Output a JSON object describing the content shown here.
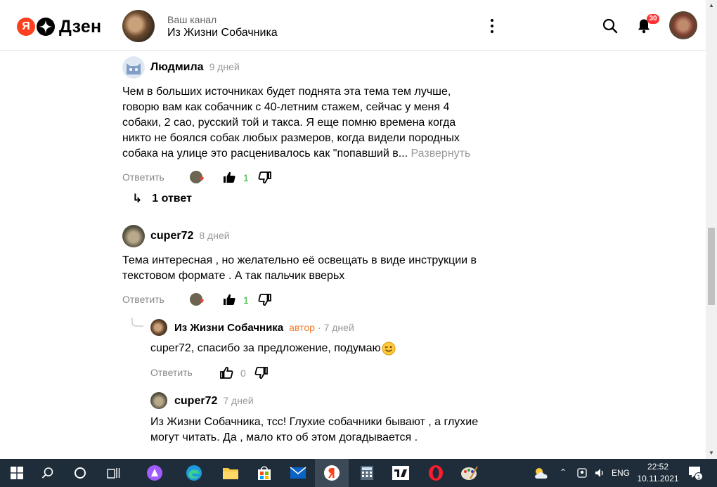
{
  "header": {
    "logo_letter": "Я",
    "logo_text": "Дзен",
    "channel_subtitle": "Ваш канал",
    "channel_title": "Из Жизни Собачника",
    "notifications_count": "30"
  },
  "comments": [
    {
      "author": "Людмила",
      "time": "9 дней",
      "text": "Чем в больших источниках будет поднята эта тема тем лучше, говорю вам как собачник с 40-летним стажем, сейчас у меня 4 собаки, 2 сао, русский той и такса. Я еще помню времена когда никто не боялся собак любых размеров, когда видели породных собака на улице это расценивалось как \"попавший в...",
      "expand_label": "Развернуть",
      "reply_label": "Ответить",
      "likes": "1",
      "replies_label": "1 ответ"
    },
    {
      "author": "cuper72",
      "time": "8 дней",
      "text": "Тема интересная , но желательно её освещать в виде инструкции в текстовом формате . А так пальчик вверьх",
      "reply_label": "Ответить",
      "likes": "1"
    }
  ],
  "replies": [
    {
      "author": "Из Жизни Собачника",
      "author_badge": "автор",
      "separator": "·",
      "time": "7 дней",
      "text": "cuper72, спасибо за предложение, подумаю",
      "reply_label": "Ответить",
      "likes": "0"
    },
    {
      "author": "cuper72",
      "time": "7 дней",
      "text": "Из Жизни Собачника, тсс! Глухие собачники бывают , а глухие могут читать. Да , мало кто об этом догадывается ."
    }
  ],
  "taskbar": {
    "language": "ENG",
    "time": "22:52",
    "date": "10.11.2021",
    "notification_count": "1"
  },
  "colors": {
    "brand_red": "#fc3f1d",
    "author_orange": "#f07b2b",
    "like_green": "#2bb52b",
    "taskbar": "#1f2d3a"
  }
}
